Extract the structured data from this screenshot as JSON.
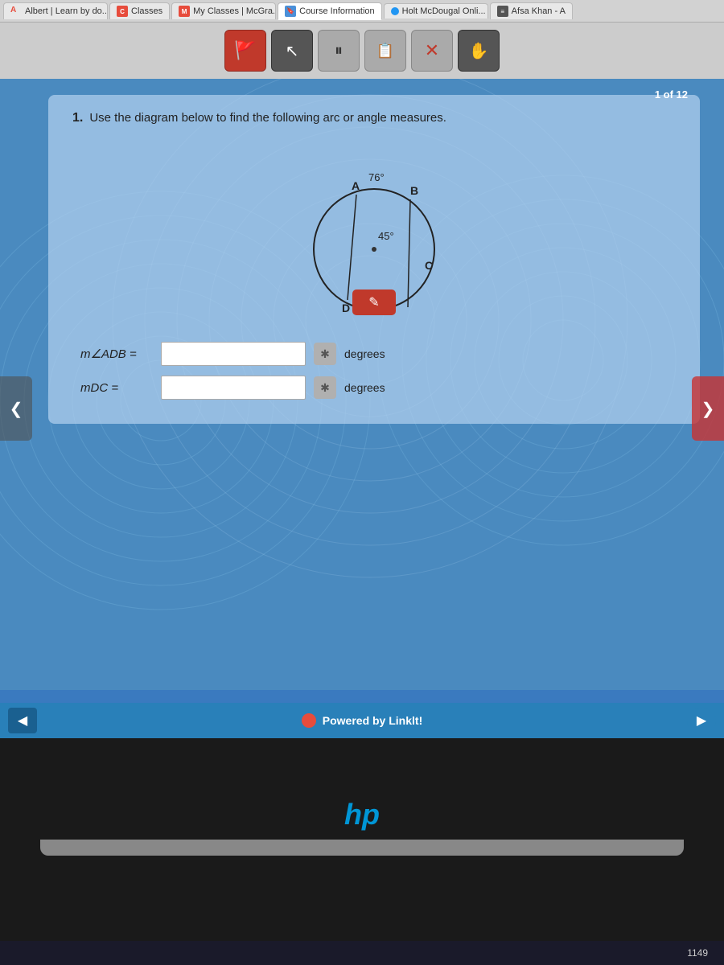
{
  "tabs": [
    {
      "id": "albert",
      "label": "Albert | Learn by do...",
      "icon": "albert-icon",
      "active": false
    },
    {
      "id": "classes",
      "label": "Classes",
      "icon": "classes-icon",
      "active": false
    },
    {
      "id": "mcgra",
      "label": "My Classes | McGra...",
      "icon": "mcgra-icon",
      "active": false
    },
    {
      "id": "course",
      "label": "Course Information",
      "icon": "course-icon",
      "active": true
    },
    {
      "id": "holt",
      "label": "Holt McDougal Onli...",
      "icon": "holt-icon",
      "active": false
    },
    {
      "id": "afsa",
      "label": "Afsa Khan - A",
      "icon": "afsa-icon",
      "active": false
    }
  ],
  "toolbar": {
    "buttons": [
      {
        "id": "btn1",
        "icon": "🚩",
        "style": "red"
      },
      {
        "id": "btn2",
        "icon": "✗",
        "style": "dark"
      },
      {
        "id": "btn3",
        "icon": "⏸",
        "style": "gray"
      },
      {
        "id": "btn4",
        "icon": "📋",
        "style": "gray"
      },
      {
        "id": "btn5",
        "icon": "✗",
        "style": "gray"
      },
      {
        "id": "btn6",
        "icon": "✋",
        "style": "dark"
      }
    ]
  },
  "question": {
    "counter": "1 of 12",
    "number": "1.",
    "text": "Use the diagram below to find the following arc or angle measures.",
    "diagram": {
      "arc_label": "76°",
      "angle_label": "45°",
      "points": [
        "A",
        "B",
        "C",
        "D"
      ]
    },
    "fields": [
      {
        "id": "m_adb",
        "label": "m∠ADB =",
        "placeholder": "",
        "badge": "✱",
        "unit": "degrees"
      },
      {
        "id": "m_dc",
        "label": "mDC =",
        "placeholder": "",
        "badge": "✱",
        "unit": "degrees"
      }
    ]
  },
  "bottom_bar": {
    "powered_by": "Powered by Linklt!"
  },
  "hp_logo": "hp",
  "taskbar": {
    "time": "1149"
  }
}
